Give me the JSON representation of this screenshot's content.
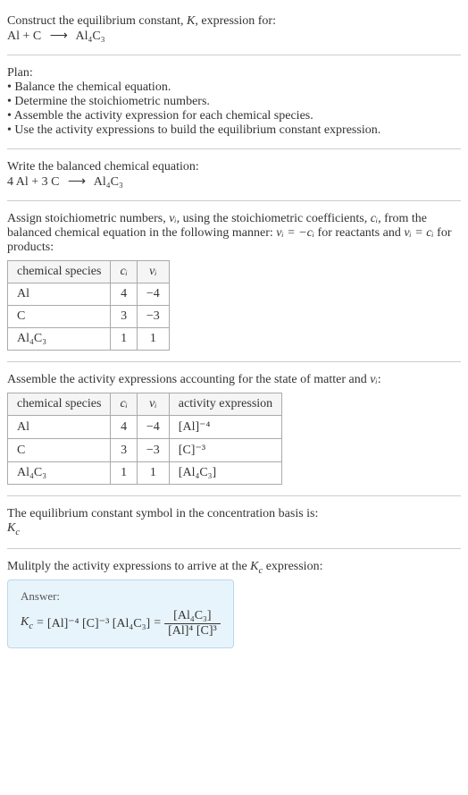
{
  "header": {
    "title_prefix": "Construct the equilibrium constant, ",
    "title_var": "K",
    "title_suffix": ", expression for:",
    "reaction_left": "Al + C",
    "reaction_arrow": "⟶",
    "reaction_right": "Al₄C₃"
  },
  "plan": {
    "heading": "Plan:",
    "items": [
      "• Balance the chemical equation.",
      "• Determine the stoichiometric numbers.",
      "• Assemble the activity expression for each chemical species.",
      "• Use the activity expressions to build the equilibrium constant expression."
    ]
  },
  "balanced": {
    "heading": "Write the balanced chemical equation:",
    "equation_left": "4 Al + 3 C",
    "equation_arrow": "⟶",
    "equation_right": "Al₄C₃"
  },
  "stoich": {
    "text1": "Assign stoichiometric numbers, ",
    "nu": "νᵢ",
    "text2": ", using the stoichiometric coefficients, ",
    "ci": "cᵢ",
    "text3": ", from the balanced chemical equation in the following manner: ",
    "formula1": "νᵢ = −cᵢ",
    "text4": " for reactants and ",
    "formula2": "νᵢ = cᵢ",
    "text5": " for products:",
    "table": {
      "headers": [
        "chemical species",
        "cᵢ",
        "νᵢ"
      ],
      "rows": [
        {
          "species": "Al",
          "c": "4",
          "nu": "−4"
        },
        {
          "species": "C",
          "c": "3",
          "nu": "−3"
        },
        {
          "species": "Al₄C₃",
          "c": "1",
          "nu": "1"
        }
      ]
    }
  },
  "activity": {
    "text1": "Assemble the activity expressions accounting for the state of matter and ",
    "nu": "νᵢ",
    "text2": ":",
    "table": {
      "headers": [
        "chemical species",
        "cᵢ",
        "νᵢ",
        "activity expression"
      ],
      "rows": [
        {
          "species": "Al",
          "c": "4",
          "nu": "−4",
          "expr": "[Al]⁻⁴"
        },
        {
          "species": "C",
          "c": "3",
          "nu": "−3",
          "expr": "[C]⁻³"
        },
        {
          "species": "Al₄C₃",
          "c": "1",
          "nu": "1",
          "expr": "[Al₄C₃]"
        }
      ]
    }
  },
  "symbol": {
    "text": "The equilibrium constant symbol in the concentration basis is:",
    "kc": "K_c"
  },
  "multiply": {
    "text1": "Mulitply the activity expressions to arrive at the ",
    "kc": "K_c",
    "text2": " expression:"
  },
  "answer": {
    "label": "Answer:",
    "kc": "K_c",
    "eq": " = ",
    "lhs": "[Al]⁻⁴ [C]⁻³ [Al₄C₃]",
    "eq2": " = ",
    "frac_num": "[Al₄C₃]",
    "frac_den": "[Al]⁴ [C]³"
  },
  "chart_data": {
    "type": "table",
    "tables": [
      {
        "title": "Stoichiometric numbers",
        "columns": [
          "chemical species",
          "c_i",
          "nu_i"
        ],
        "rows": [
          [
            "Al",
            4,
            -4
          ],
          [
            "C",
            3,
            -3
          ],
          [
            "Al4C3",
            1,
            1
          ]
        ]
      },
      {
        "title": "Activity expressions",
        "columns": [
          "chemical species",
          "c_i",
          "nu_i",
          "activity expression"
        ],
        "rows": [
          [
            "Al",
            4,
            -4,
            "[Al]^-4"
          ],
          [
            "C",
            3,
            -3,
            "[C]^-3"
          ],
          [
            "Al4C3",
            1,
            1,
            "[Al4C3]"
          ]
        ]
      }
    ]
  }
}
